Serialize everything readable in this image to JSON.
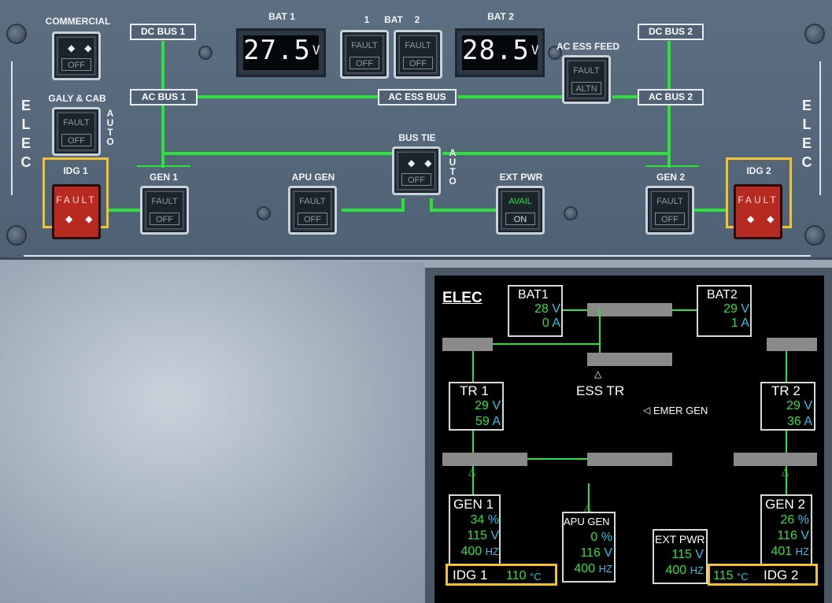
{
  "panel": {
    "side_label": "ELEC",
    "commercial": {
      "caption": "COMMERCIAL",
      "lower": "OFF"
    },
    "galy_cab": {
      "caption": "GALY & CAB",
      "upper": "FAULT",
      "lower": "OFF",
      "side": "AUTO"
    },
    "idg1": {
      "caption": "IDG 1",
      "label": "FAULT"
    },
    "idg2": {
      "caption": "IDG 2",
      "label": "FAULT"
    },
    "dc_bus_1": "DC BUS 1",
    "dc_bus_2": "DC BUS 2",
    "ac_bus_1": "AC BUS 1",
    "ac_bus_2": "AC BUS 2",
    "ac_ess_bus": "AC ESS BUS",
    "bat1_display": {
      "caption": "BAT 1",
      "value": "27.5",
      "unit": "V"
    },
    "bat2_display": {
      "caption": "BAT 2",
      "value": "28.5",
      "unit": "V"
    },
    "bat_buttons": {
      "caption_left": "1",
      "caption_mid": "BAT",
      "caption_right": "2",
      "upper": "FAULT",
      "lower": "OFF"
    },
    "ac_ess_feed": {
      "caption": "AC ESS FEED",
      "upper": "FAULT",
      "lower": "ALTN"
    },
    "bus_tie": {
      "caption": "BUS TIE",
      "lower": "OFF",
      "side": "AUTO"
    },
    "gen1": {
      "caption": "GEN 1",
      "upper": "FAULT",
      "lower": "OFF"
    },
    "gen2": {
      "caption": "GEN 2",
      "upper": "FAULT",
      "lower": "OFF"
    },
    "apu_gen": {
      "caption": "APU GEN",
      "upper": "FAULT",
      "lower": "OFF"
    },
    "ext_pwr": {
      "caption": "EXT PWR",
      "upper": "AVAIL",
      "lower": "ON"
    }
  },
  "ecam": {
    "title": "ELEC",
    "bat1": {
      "label": "BAT1",
      "volts": "28",
      "v_unit": "V",
      "amps": "0",
      "a_unit": "A"
    },
    "bat2": {
      "label": "BAT2",
      "volts": "29",
      "v_unit": "V",
      "amps": "1",
      "a_unit": "A"
    },
    "ess_tr": "ESS TR",
    "emer_gen": "EMER GEN",
    "tr1": {
      "label": "TR 1",
      "volts": "29",
      "v_unit": "V",
      "amps": "59",
      "a_unit": "A"
    },
    "tr2": {
      "label": "TR 2",
      "volts": "29",
      "v_unit": "V",
      "amps": "36",
      "a_unit": "A"
    },
    "gen1": {
      "label": "GEN 1",
      "load": "34",
      "load_unit": "%",
      "volts": "115",
      "v_unit": "V",
      "freq": "400",
      "f_unit": "HZ"
    },
    "gen2": {
      "label": "GEN 2",
      "load": "26",
      "load_unit": "%",
      "volts": "116",
      "v_unit": "V",
      "freq": "401",
      "f_unit": "HZ"
    },
    "apu_gen": {
      "label": "APU GEN",
      "load": "0",
      "load_unit": "%",
      "volts": "116",
      "v_unit": "V",
      "freq": "400",
      "f_unit": "HZ"
    },
    "ext_pwr": {
      "label": "EXT PWR",
      "volts": "115",
      "v_unit": "V",
      "freq": "400",
      "f_unit": "HZ"
    },
    "idg1": {
      "label": "IDG 1",
      "temp": "110",
      "unit": "°C"
    },
    "idg2": {
      "label": "IDG 2",
      "temp": "115",
      "unit": "°C"
    }
  },
  "colors": {
    "flow_green": "#2ee03a",
    "cyan": "#29c3e6",
    "guard_yellow": "#f2c230",
    "idg_red": "#b72a22"
  }
}
